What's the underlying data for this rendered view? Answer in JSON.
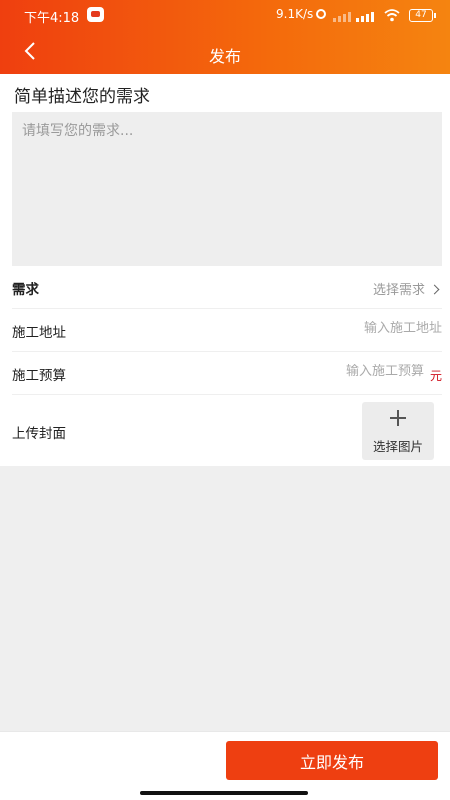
{
  "status_bar": {
    "time": "下午4:18",
    "net_speed": "9.1K/s",
    "battery": "47"
  },
  "header": {
    "title": "发布",
    "back_icon": "chevron-left-icon"
  },
  "form": {
    "description_heading": "简单描述您的需求",
    "description_placeholder": "请填写您的需求...",
    "demand": {
      "label": "需求",
      "value": "选择需求"
    },
    "address": {
      "label": "施工地址",
      "placeholder": "输入施工地址"
    },
    "budget": {
      "label": "施工预算",
      "placeholder": "输入施工预算",
      "unit": "元"
    },
    "cover": {
      "label": "上传封面",
      "button_label": "选择图片"
    }
  },
  "footer": {
    "publish_label": "立即发布"
  },
  "colors": {
    "header_start": "#ef3f0f",
    "header_end": "#f58410",
    "publish_button": "#ee3f11",
    "unit_text": "#d0121e"
  }
}
